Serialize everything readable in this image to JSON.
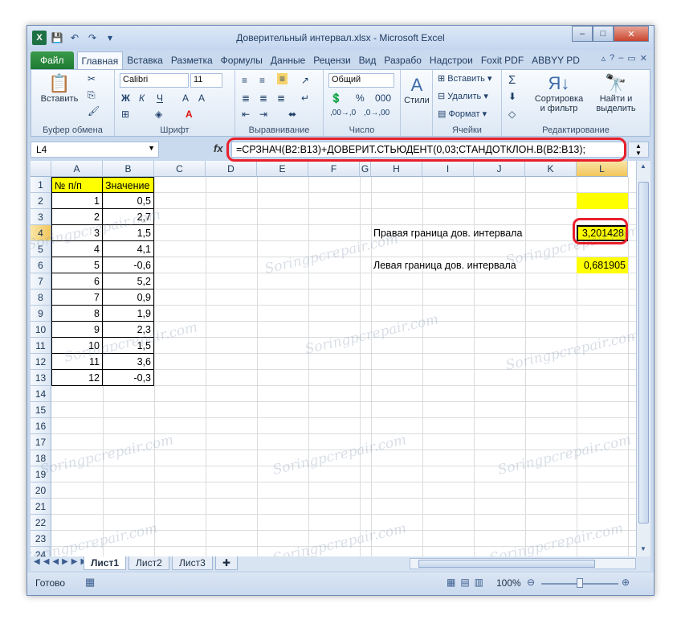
{
  "app": {
    "title": "Доверительный интервал.xlsx - Microsoft Excel",
    "logo": "X"
  },
  "window_buttons": {
    "minimize": "–",
    "maximize": "□",
    "close": "✕"
  },
  "tabs": [
    {
      "label": "Файл"
    },
    {
      "label": "Главная"
    },
    {
      "label": "Вставка"
    },
    {
      "label": "Разметка"
    },
    {
      "label": "Формулы"
    },
    {
      "label": "Данные"
    },
    {
      "label": "Рецензи"
    },
    {
      "label": "Вид"
    },
    {
      "label": "Разрабо"
    },
    {
      "label": "Надстрои"
    },
    {
      "label": "Foxit PDF"
    },
    {
      "label": "ABBYY PD"
    }
  ],
  "ribbon": {
    "clipboard": {
      "group_label": "Буфер обмена",
      "paste_label": "Вставить"
    },
    "font": {
      "group_label": "Шрифт",
      "font_name": "Calibri",
      "font_size": "11",
      "bold": "Ж",
      "italic": "К",
      "underline": "Ч"
    },
    "alignment": {
      "group_label": "Выравнивание"
    },
    "number": {
      "group_label": "Число",
      "format": "Общий"
    },
    "styles": {
      "label": "Стили"
    },
    "cells": {
      "group_label": "Ячейки",
      "insert": "Вставить",
      "delete": "Удалить",
      "format": "Формат"
    },
    "editing": {
      "group_label": "Редактирование",
      "sort_line1": "Сортировка",
      "sort_line2": "и фильтр",
      "find_line1": "Найти и",
      "find_line2": "выделить"
    }
  },
  "formula_bar": {
    "name_box": "L4",
    "fx": "fx",
    "formula": "=СРЗНАЧ(B2:B13)+ДОВЕРИТ.СТЬЮДЕНТ(0,03;СТАНДОТКЛОН.В(B2:B13);"
  },
  "columns": [
    "A",
    "B",
    "C",
    "D",
    "E",
    "F",
    "G",
    "H",
    "I",
    "J",
    "K",
    "L"
  ],
  "rows": [
    "1",
    "2",
    "3",
    "4",
    "5",
    "6",
    "7",
    "8",
    "9",
    "10",
    "11",
    "12",
    "13",
    "14",
    "15",
    "16",
    "17",
    "18",
    "19",
    "20",
    "21",
    "22",
    "23",
    "24"
  ],
  "table": {
    "header_a": "№ п/п",
    "header_b": "Значение",
    "rows": [
      {
        "n": "1",
        "v": "0,5"
      },
      {
        "n": "2",
        "v": "2,7"
      },
      {
        "n": "3",
        "v": "1,5"
      },
      {
        "n": "4",
        "v": "4,1"
      },
      {
        "n": "5",
        "v": "-0,6"
      },
      {
        "n": "6",
        "v": "5,2"
      },
      {
        "n": "7",
        "v": "0,9"
      },
      {
        "n": "8",
        "v": "1,9"
      },
      {
        "n": "9",
        "v": "2,3"
      },
      {
        "n": "10",
        "v": "1,5"
      },
      {
        "n": "11",
        "v": "3,6"
      },
      {
        "n": "12",
        "v": "-0,3"
      }
    ]
  },
  "results": {
    "right_label": "Правая граница дов. интервала",
    "right_value": "3,201428",
    "left_label": "Левая граница дов. интервала",
    "left_value": "0,681905"
  },
  "sheets": [
    "Лист1",
    "Лист2",
    "Лист3"
  ],
  "status": {
    "ready": "Готово",
    "zoom": "100%"
  },
  "watermark": "Soringpcrepair.com",
  "colors": {
    "accent_red": "#e8202b",
    "highlight_yellow": "#ffff00",
    "excel_green": "#1e7145"
  }
}
